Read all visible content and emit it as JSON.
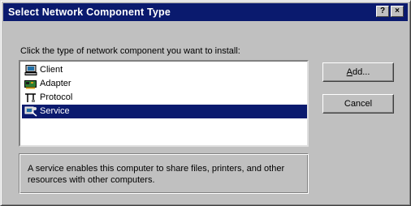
{
  "window": {
    "title": "Select Network Component Type",
    "help_button": "?",
    "close_button": "×"
  },
  "instruction": "Click the type of network component you want to install:",
  "components": [
    {
      "label": "Client",
      "icon": "client-icon",
      "selected": false
    },
    {
      "label": "Adapter",
      "icon": "adapter-icon",
      "selected": false
    },
    {
      "label": "Protocol",
      "icon": "protocol-icon",
      "selected": false
    },
    {
      "label": "Service",
      "icon": "service-icon",
      "selected": true
    }
  ],
  "buttons": {
    "add_mnemonic": "A",
    "add_rest": "dd...",
    "cancel": "Cancel"
  },
  "description": "A service enables this computer to share files, printers, and other resources with other computers.",
  "colors": {
    "dialog_face": "#c0c0c0",
    "titlebar": "#0a1a6e",
    "selection": "#0a1a6e"
  }
}
